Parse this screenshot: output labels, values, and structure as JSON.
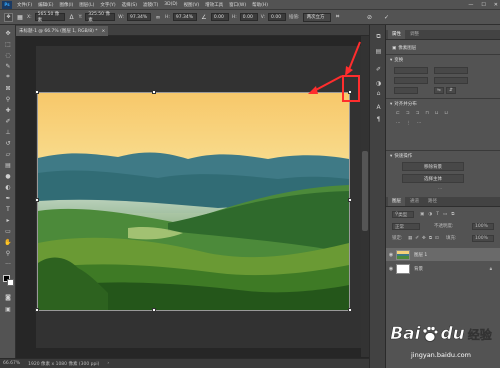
{
  "menubar": {
    "logo": "Ps",
    "items": [
      "文件(F)",
      "编辑(E)",
      "图像(I)",
      "图层(L)",
      "文字(Y)",
      "选择(S)",
      "滤镜(T)",
      "3D(D)",
      "视图(V)",
      "增效工具",
      "窗口(W)",
      "帮助(H)"
    ],
    "window_controls": [
      "—",
      "☐",
      "✕"
    ]
  },
  "options": {
    "x_label": "X:",
    "x_value": "565.50 像素",
    "y_label": "Y:",
    "y_value": "325.50 像素",
    "w_label": "W:",
    "w_value": "97.34%",
    "h_label": "H:",
    "h_value": "97.34%",
    "angle_value": "0.00",
    "hskew_label": "H:",
    "hskew_value": "0.00",
    "vskew_label": "V:",
    "vskew_value": "0.00",
    "interp_label": "插值:",
    "interp_value": "两次立方",
    "cancel_icon": "⊘",
    "commit_icon": "✓"
  },
  "document": {
    "tab_title": "未标题-1 @ 66.7% (图层 1, RGB/8) *",
    "tab_close": "×"
  },
  "status": {
    "zoom": "66.67%",
    "doc_info": "1920 像素 x 1080 像素 (300 ppi)"
  },
  "properties": {
    "tabs": [
      "属性",
      "调整"
    ],
    "section_title": "像素图层",
    "transform_title": "变换",
    "align_title": "对齐并分布",
    "quick_actions_title": "快速操作",
    "btn_remove_bg": "移除背景",
    "btn_select_subject": "选择主体"
  },
  "layers": {
    "tabs": [
      "图层",
      "通道",
      "路径"
    ],
    "kind_label": "类型",
    "blend_mode": "正常",
    "opacity_label": "不透明度:",
    "opacity_value": "100%",
    "lock_label": "锁定:",
    "fill_label": "填充:",
    "fill_value": "100%",
    "items": [
      {
        "name": "图层 1"
      },
      {
        "name": "背景"
      }
    ]
  },
  "watermark": {
    "bai": "Bai",
    "du": "du",
    "jingyan": "经验",
    "url": "jingyan.baidu.com"
  }
}
